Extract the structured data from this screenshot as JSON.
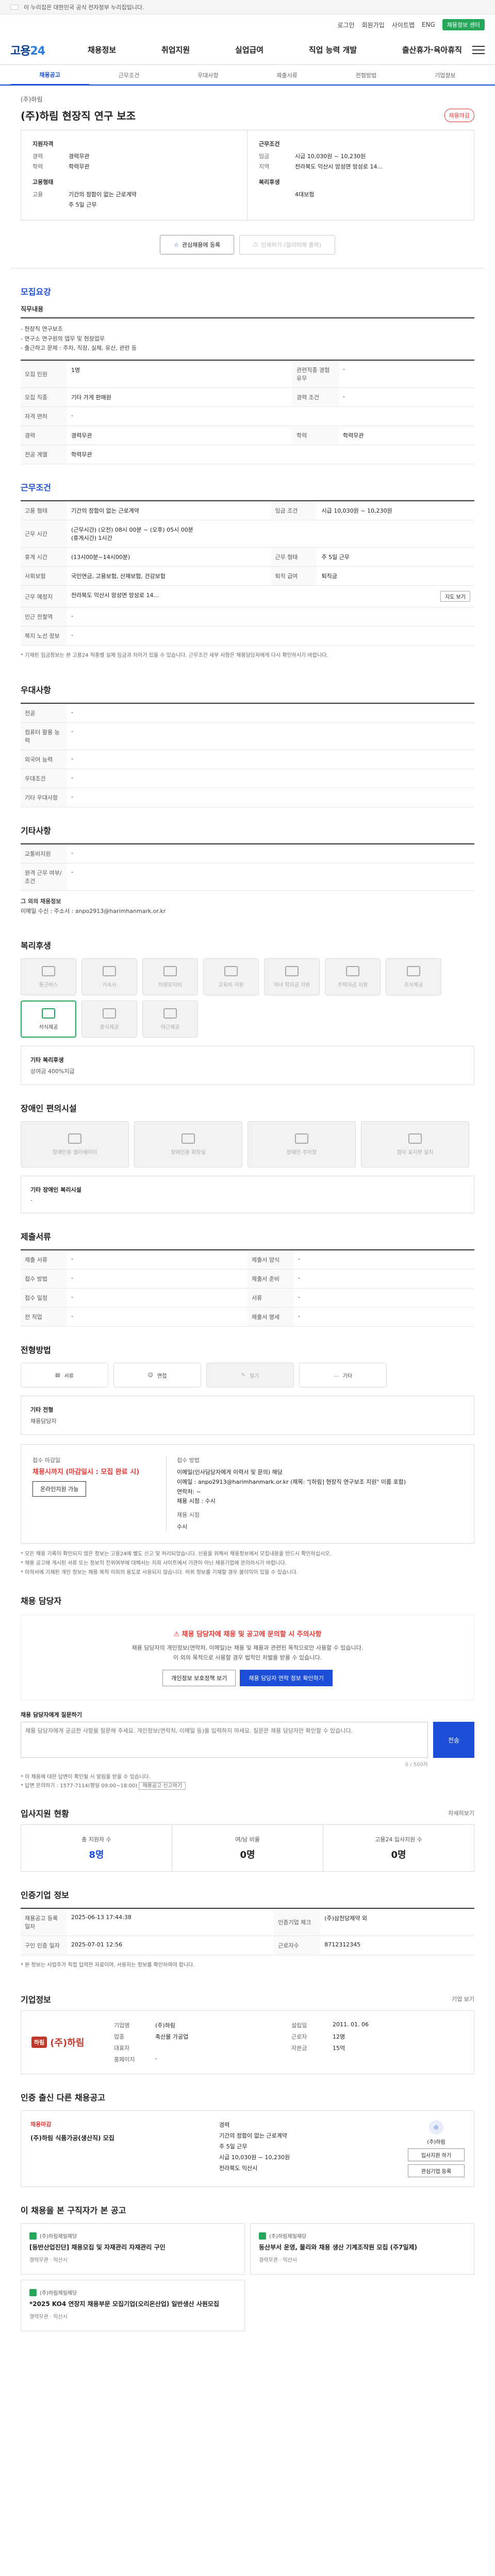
{
  "topbar": {
    "notice": "이 누리집은 대한민국 공식 전자정부 누리집입니다."
  },
  "util": {
    "login": "로그인",
    "join": "회원가입",
    "sitemap": "사이트맵",
    "lang": "ENG",
    "btn": "채용정보 센터"
  },
  "logo": {
    "main": "고용",
    "accent": "24"
  },
  "gnb": [
    "채용정보",
    "취업지원",
    "실업급여",
    "직업 능력 개발",
    "출산휴가·육아휴직"
  ],
  "tabs": [
    "채용공고",
    "근무조건",
    "우대사항",
    "제출서류",
    "전형방법",
    "기업정보"
  ],
  "job": {
    "company": "(주)하림",
    "title": "(주)하림 현장직 연구 보조",
    "badge": "채용마감",
    "left_title": "지원자격",
    "left": [
      {
        "k": "경력",
        "v": "경력무관"
      },
      {
        "k": "학력",
        "v": "학력무관"
      }
    ],
    "left2_title": "고용형태",
    "left2": [
      {
        "k": "고용",
        "v": "기간의 정함이 없는 근로계약"
      },
      {
        "k": "",
        "v": "주 5일 근무"
      }
    ],
    "right_title": "근무조건",
    "right": [
      {
        "k": "임금",
        "v": "시급 10,030원 ~ 10,230원"
      },
      {
        "k": "지역",
        "v": "전라북도 익산시 망성면 망성로 14..."
      }
    ],
    "right2_title": "복리후생",
    "right2": [
      {
        "k": "",
        "v": "4대보험"
      }
    ]
  },
  "actions": {
    "scrap": "관심채용에 등록",
    "print": "인쇄하기 (알리미에 출력)"
  },
  "recruit": {
    "title": "모집요강",
    "duty_h": "직무내용",
    "duty": "- 현장직 연구보조\n- 연구소 연구원의 업무 및 현장업무\n- 출근하고 문제 : 주차, 직장, 실체, 유산, 관련 등",
    "rows": [
      [
        "모집 인원",
        "1명",
        "관련직종 경험 유무",
        "-"
      ],
      [
        "모집 직종",
        "기타 가게 판매원",
        "경력 조건",
        "-"
      ],
      [
        "자격 면허",
        "-",
        "",
        ""
      ],
      [
        "경력",
        "경력무관",
        "학력",
        "학력무관"
      ],
      [
        "전공 계열",
        "학력무관",
        "",
        ""
      ]
    ]
  },
  "work": {
    "title": "근무조건",
    "rows": [
      [
        "고용 형태",
        "기간의 정함이 없는 근로계약",
        "임금 조건",
        "시급 10,030원 ~ 10,230원"
      ],
      [
        "근무 시간",
        "(근무시간) (오전) 08시 00분 ~ (오후) 05시 00분\n(휴게시간) 1시간",
        "",
        ""
      ],
      [
        "휴게 시간",
        "(13시00분~14시00분)",
        "근무 형태",
        "주 5일 근무"
      ],
      [
        "사회보험",
        "국민연금, 고용보험, 산재보험, 건강보험",
        "퇴직 급여",
        "퇴직금"
      ],
      [
        "근무 예정지",
        "전라북도 익산시 망성면 망성로 14...",
        "지도 보기",
        ""
      ],
      [
        "인근 전철역",
        "-",
        "",
        ""
      ],
      [
        "복지 노선 정보",
        "-",
        "",
        ""
      ]
    ],
    "note": "* 기재된 임금정보는 본 고용24 직종별 실제 임금과 차이가 있을 수 있습니다. 근무조건 세부 사항은 채용담당자에게 다시 확인하시기 바랍니다."
  },
  "pref": {
    "title": "우대사항",
    "rows": [
      [
        "전공",
        "-"
      ],
      [
        "컴퓨터 활용 능력",
        "-"
      ],
      [
        "외국어 능력",
        "-"
      ],
      [
        "우대조건",
        "-"
      ],
      [
        "기타 우대사항",
        "-"
      ]
    ]
  },
  "etc": {
    "title": "기타사항",
    "rows": [
      [
        "교통비지원",
        "-"
      ],
      [
        "원격 근무 여부/조건",
        "-"
      ]
    ],
    "contact_title": "그 외의 채용정보",
    "contact": "이메일 수신 : 주소서 : anpo2913@harimhanmark.or.kr"
  },
  "welfare": {
    "title": "복리후생",
    "items": [
      {
        "label": "통근버스",
        "on": false
      },
      {
        "label": "기숙사",
        "on": false
      },
      {
        "label": "차량유지비",
        "on": false
      },
      {
        "label": "교육비 지원",
        "on": false
      },
      {
        "label": "자녀 학자금 지원",
        "on": false
      },
      {
        "label": "주택자금 지원",
        "on": false
      },
      {
        "label": "조식제공",
        "on": false
      },
      {
        "label": "석식제공",
        "on": true
      },
      {
        "label": "중식제공",
        "on": false
      },
      {
        "label": "야근제공",
        "on": false
      }
    ],
    "extra_h": "기타 복리후생",
    "extra_v": "상여금 400%지급"
  },
  "disability": {
    "title": "장애인 편의시설",
    "items": [
      "장애인용 엘리베이터",
      "장애인용 화장실",
      "장애인 주차장",
      "점자 표지판 설치"
    ],
    "extra_h": "기타 장애인 복리시설",
    "extra_v": "-"
  },
  "docs": {
    "title": "제출서류",
    "rows": [
      [
        "제출 서류",
        "-",
        "제출서 양식",
        "-"
      ],
      [
        "접수 방법",
        "-",
        "제출서 준비",
        "-"
      ],
      [
        "접수 일정",
        "-",
        "서류",
        "-"
      ],
      [
        "전 직업",
        "-",
        "제출서 명세",
        "-"
      ]
    ]
  },
  "apply": {
    "title": "전형방법",
    "methods": [
      {
        "label": "서류",
        "on": false
      },
      {
        "label": "면접",
        "on": false
      },
      {
        "label": "필기",
        "on": true
      },
      {
        "label": "기타",
        "on": false
      }
    ],
    "extra_h": "기타 전형",
    "extra_v": "채용담당자",
    "deadline_label": "접수 마감일",
    "deadline": "채용시까지 (마감일시 : 모집 완료 시)",
    "btn": "온라인지원 가능",
    "method_label": "접수 방법",
    "method": "이메일(인사담당자에게 이력서 및 문의) 해당\n이메일 : anpo2913@harimhanmark.or.kr (제목: \"[하림] 현장직 연구보조 지원\" 이름 포함)\n 연락처: ~\n채용 시점 : 수시",
    "how_label": "채용 시점",
    "how": "수시",
    "bullets": [
      "* 모든 채용 기록이 확인되지 않은 정보는 고용24에 별도 신고 및 처리되었습니다. 신용을 위해서 채용정보에서 모집내용을 반드시 확인하십시오.",
      "* 채용 공고에 게시된 서류 또는 정보의 진위여부에 대해서는 저희 사이트에서 기관이 아닌 채용기업에 문의하시기 바랍니다.",
      "* 이력서에 기재된 개인 정보는 채용 목적 이외의 용도로 사용되지 않습니다. 허위 정보를 기재할 경우 불이익이 있을 수 있습니다."
    ]
  },
  "inquiry": {
    "title": "채용 담당자",
    "headline": "채용 담당자에 채용 및 공고에 문의할 시 주의사항",
    "lines": [
      "채용 담당자의 개인정보(연락처, 이메일)는 채용 및 채용과 관련된 목적으로만 사용할 수 있습니다.",
      "이 외의 목적으로 사용할 경우 법적인 처벌을 받을 수 있습니다."
    ],
    "btn1": "개인정보 보호정책 보기",
    "btn2": "채용 담당자 연락 정보 확인하기",
    "form_label": "채용 담당자에게 질문하기",
    "placeholder": "채용 담당자에게 궁금한 사항을 질문해 주세요. 개인정보(연락처, 이메일 등)를 입력하지 마세요. 질문은 채용 담당자만 확인할 수 있습니다.",
    "submit": "전송",
    "counter": "0 / 500자",
    "reply_notes": [
      "* 이 채용에 대한 답변이 확인될 시 알림을 받을 수 있습니다.",
      "* 답변 문의하기 : 1577-7114(평일 09:00~18:00)"
    ],
    "reply_btn": "채용공고 신고하기"
  },
  "stats": {
    "title": "입사지원 현황",
    "more": "자세히보기",
    "items": [
      {
        "label": "총 지원자 수",
        "n": "8명",
        "blue": true
      },
      {
        "label": "여/남 비율",
        "n": "0명",
        "blue": false
      },
      {
        "label": "고용24 입사지원 수",
        "n": "0명",
        "blue": false
      }
    ]
  },
  "info": {
    "title": "인증기업 정보",
    "rows": [
      [
        "채용공고 등록일자",
        "2025-06-13 17:44:38",
        "인증기업 체크",
        "(주)삼천당제약 외"
      ],
      [
        "구인 인증 일자",
        "2025-07-01 12:56",
        "근로자수",
        "8712312345"
      ]
    ],
    "note": "* 본 정보는 사업주가 직접 입력한 자료이며, 사용자는 정보를 확인하여야 합니다."
  },
  "company": {
    "title": "기업정보",
    "more": "기업 보기",
    "logo": "(주)하림",
    "mark": "하림",
    "rows": [
      [
        "기업명",
        "(주)하림",
        "설립일",
        "2011. 01. 06"
      ],
      [
        "업종",
        "축산물 가공업",
        "근로자",
        "12명"
      ],
      [
        "대표자",
        "",
        "자본금",
        "15억"
      ],
      [
        "홈페이지",
        "-",
        "",
        ""
      ]
    ]
  },
  "other": {
    "title": "인증 출신 다른 채용공고",
    "label": "채용마감",
    "name": "(주)하림 식품가공(생산직) 모집",
    "meta": [
      "경력",
      "기간의 정함이 없는 근로계약",
      "주 5일 근무",
      "시급 10,030원 ~ 10,230원",
      "전라북도 익산시"
    ],
    "logo": "(주)하림",
    "btns": [
      "입사지원 하기",
      "관심기업 등록"
    ]
  },
  "recommend": {
    "title": "이 채용을 본 구직자가 본 공고",
    "items": [
      {
        "co": "(주)하림제일제당",
        "title": "[동반산업진단] 채용모집 및 자재관리 자재관리 구인",
        "meta": "경력무관 · 익산시"
      },
      {
        "co": "(주)하림제일제당",
        "title": "동산부서 운영, 물리와 채용 생산 기계조작원 모집 (주7일제)",
        "meta": "경력무관 · 익산시"
      },
      {
        "co": "(주)하림제일제당",
        "title": "*2025 KO4 연장지 채용부문 모집기업(오리온산업) 일반생산 사원모집",
        "meta": "경력무관 · 익산시"
      }
    ]
  }
}
